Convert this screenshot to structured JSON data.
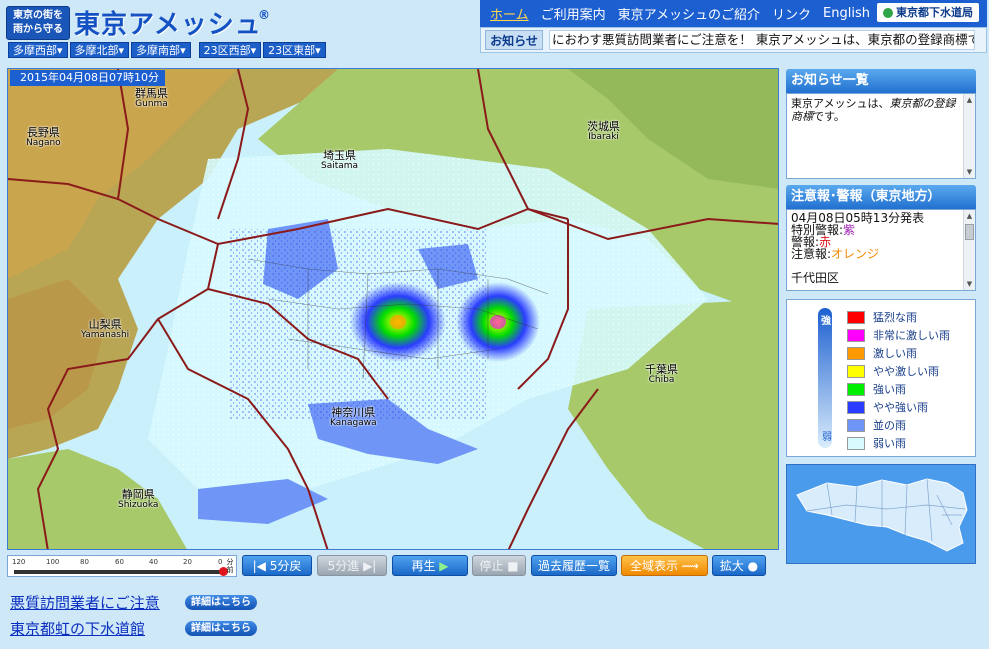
{
  "header": {
    "logo_line1": "東京の街を",
    "logo_line2": "雨から守る",
    "title": "東京アメッシュ",
    "registered": "®"
  },
  "area_tabs": [
    "多摩西部",
    "多摩北部",
    "多摩南部",
    "23区西部",
    "23区東部"
  ],
  "nav": {
    "items": [
      "ホーム",
      "ご利用案内",
      "東京アメッシュのご紹介",
      "リンク",
      "English"
    ],
    "active": "ホーム",
    "bureau": "東京都下水道局"
  },
  "notice": {
    "label": "お知らせ",
    "ticker": "におわす悪質訪問業者にご注意を！ 東京アメッシュは、東京都の登録商標で"
  },
  "map": {
    "timestamp": "2015年04月08日07時10分",
    "prefectures": [
      {
        "ja": "群馬県",
        "en": "Gunma"
      },
      {
        "ja": "長野県",
        "en": "Nagano"
      },
      {
        "ja": "茨城県",
        "en": "Ibaraki"
      },
      {
        "ja": "埼玉県",
        "en": "Saitama"
      },
      {
        "ja": "山梨県",
        "en": "Yamanashi"
      },
      {
        "ja": "千葉県",
        "en": "Chiba"
      },
      {
        "ja": "神奈川県",
        "en": "Kanagawa"
      },
      {
        "ja": "静岡県",
        "en": "Shizuoka"
      }
    ]
  },
  "timeline": {
    "ticks": [
      "120",
      "100",
      "80",
      "60",
      "40",
      "20",
      "0"
    ],
    "unit": "分前",
    "position": 0
  },
  "controls": {
    "back": "5分戻",
    "forward": "5分進",
    "play": "再生",
    "stop": "停止",
    "history": "過去履歴一覧",
    "wide": "全域表示",
    "zoom": "拡大"
  },
  "links": [
    {
      "text": "悪質訪問業者にご注意",
      "button": "詳細はこちら"
    },
    {
      "text": "東京都虹の下水道館",
      "button": "詳細はこちら"
    }
  ],
  "news": {
    "title": "お知らせ一覧",
    "text_prefix": "東京アメッシュは、",
    "text_em": "東京都の登録商標",
    "text_suffix": "です。"
  },
  "warnings": {
    "title": "注意報･警報（東京地方）",
    "issued": "04月08日05時13分発表",
    "special_label": "特別警報:",
    "special_color": "紫",
    "warning_label": "警報:",
    "warning_color": "赤",
    "advisory_label": "注意報:",
    "advisory_color": "オレンジ",
    "area": "千代田区"
  },
  "legend": {
    "strong": "強",
    "weak": "弱",
    "items": [
      {
        "label": "猛烈な雨",
        "color": "#ff0000"
      },
      {
        "label": "非常に激しい雨",
        "color": "#ff00ff"
      },
      {
        "label": "激しい雨",
        "color": "#ff9900"
      },
      {
        "label": "やや激しい雨",
        "color": "#ffff00"
      },
      {
        "label": "強い雨",
        "color": "#00ee00"
      },
      {
        "label": "やや強い雨",
        "color": "#2a3cff"
      },
      {
        "label": "並の雨",
        "color": "#6f95f7"
      },
      {
        "label": "弱い雨",
        "color": "#d6fafe"
      }
    ]
  },
  "colors": {
    "brand_blue": "#1c5fd0",
    "map_sea": "#c9f0fb",
    "land_green": "#a7c969",
    "mountain": "#c9a54e",
    "border_red": "#8b1a1a"
  }
}
